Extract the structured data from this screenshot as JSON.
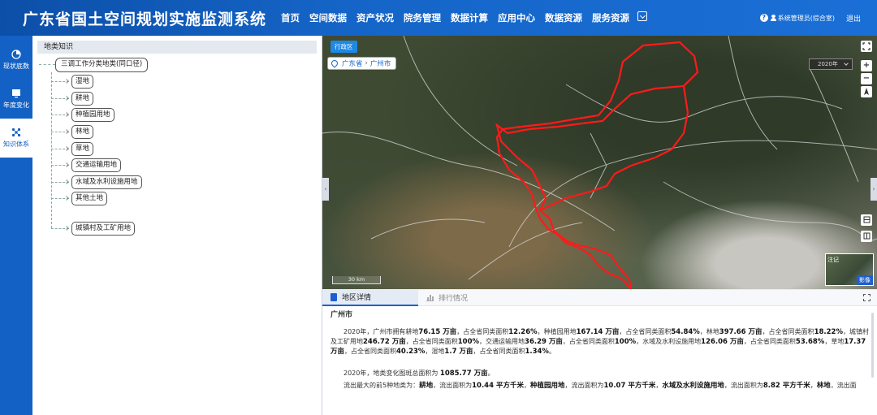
{
  "app": {
    "title": "广东省国土空间规划实施监测系统"
  },
  "nav": [
    {
      "label": "首页"
    },
    {
      "label": "空间数据"
    },
    {
      "label": "资产状况"
    },
    {
      "label": "院务管理"
    },
    {
      "label": "数据计算"
    },
    {
      "label": "应用中心"
    },
    {
      "label": "数据资源"
    },
    {
      "label": "服务资源"
    }
  ],
  "user": {
    "name": "系统管理员(综合室)",
    "logout": "退出"
  },
  "rail": [
    {
      "label": "现状底数",
      "icon": "pie-chart-icon"
    },
    {
      "label": "年度变化",
      "icon": "monitor-icon"
    },
    {
      "label": "知识体系",
      "icon": "network-icon",
      "active": true
    }
  ],
  "tree": {
    "header": "地类知识",
    "root": "三调工作分类地类(同口径)",
    "children": [
      "湿地",
      "耕地",
      "种植园用地",
      "林地",
      "草地",
      "交通运输用地",
      "水域及水利设施用地",
      "其他土地",
      "城镇村及工矿用地"
    ]
  },
  "map": {
    "region_tag": "行政区",
    "breadcrumb": {
      "province": "广东省",
      "separator": "›",
      "city": "广州市"
    },
    "year": "2020年",
    "zoom_in": "+",
    "zoom_out": "−",
    "scale": "30 km",
    "basemap_note": "注记",
    "basemap_label": "影像"
  },
  "details": {
    "tabs": [
      {
        "label": "地区详情",
        "active": true
      },
      {
        "label": "排行情况",
        "active": false
      }
    ],
    "city": "广州市",
    "p1": {
      "a": "2020年，广州市拥有耕地",
      "v1": "76.15 万亩",
      "b": "，占全省同类面积",
      "v2": "12.26%",
      "c": "，种植园用地",
      "v3": "167.14 万亩",
      "d": "，占全省同类面积",
      "v4": "54.84%",
      "e": "，林地",
      "v5": "397.66 万亩",
      "f": "，占全省同类面积",
      "v6": "18.22%",
      "g": "，城镇村及工矿用地",
      "v7": "246.72 万亩",
      "h": "，占全省同类面积",
      "v8": "100%",
      "i": "，交通运输用地",
      "v9": "36.29 万亩",
      "j": "，占全省同类面积",
      "v10": "100%",
      "k": "，水域及水利设施用地",
      "v11": "126.06 万亩",
      "l": "，占全省同类面积",
      "v12": "53.68%",
      "m": "，草地",
      "v13": "17.37 万亩",
      "n": "，占全省同类面积",
      "v14": "40.23%",
      "o": "，湿地",
      "v15": "1.7 万亩",
      "p": "，占全省同类面积",
      "v16": "1.34%",
      "q": "。"
    },
    "p2": {
      "a": "2020年，地类变化图斑总面积为",
      "v": "1085.77 万亩",
      "b": "。"
    },
    "p3": {
      "a": "流出最大的前5种地类为：",
      "k1": "耕地",
      "b": "，流出面积为",
      "v1": "10.44 平方千米",
      "c": "，",
      "k2": "种植园用地",
      "d": "，流出面积为",
      "v2": "10.07 平方千米",
      "e": "，",
      "k3": "水域及水利设施用地",
      "f": "，流出面积为",
      "v3": "8.82 平方千米",
      "g": "，",
      "k4": "林地",
      "h": "，流出面"
    }
  }
}
